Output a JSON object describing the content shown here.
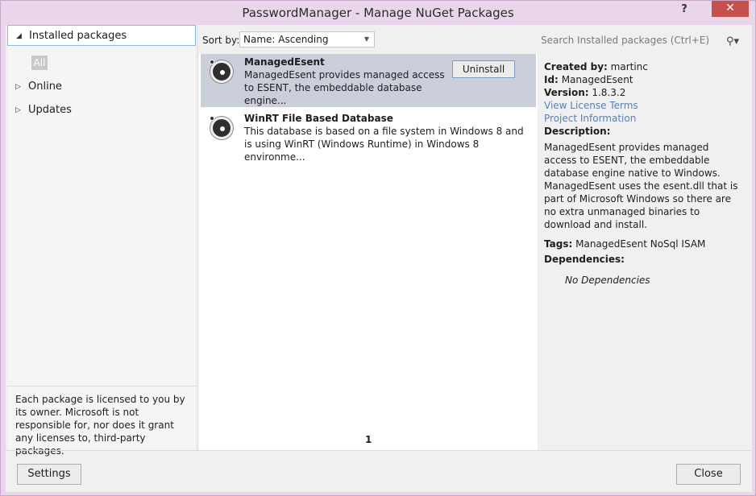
{
  "window": {
    "title": "PasswordManager - Manage NuGet Packages",
    "help_glyph": "?",
    "close_glyph": "✕"
  },
  "sidebar": {
    "items": [
      {
        "label": "Installed packages",
        "arrow": "◢"
      },
      {
        "label": "Online",
        "arrow": "▷"
      },
      {
        "label": "Updates",
        "arrow": "▷"
      }
    ],
    "filter_chip": "All",
    "license_note": "Each package is licensed to you by its owner. Microsoft is not responsible for, nor does it grant any licenses to, third-party packages."
  },
  "toolbar": {
    "sort_label": "Sort by:",
    "sort_value": "Name: Ascending",
    "search_placeholder": "Search Installed packages (Ctrl+E)"
  },
  "packages": [
    {
      "name": "ManagedEsent",
      "description": "ManagedEsent provides managed access to ESENT, the embeddable database engine...",
      "action": "Uninstall",
      "selected": true
    },
    {
      "name": "WinRT File Based Database",
      "description": "This database is based on a file system in Windows 8 and is using WinRT (Windows Runtime) in Windows 8 environme...",
      "selected": false
    }
  ],
  "pager": {
    "current_page": "1"
  },
  "details": {
    "created_by_label": "Created by:",
    "created_by": "martinc",
    "id_label": "Id:",
    "id": "ManagedEsent",
    "version_label": "Version:",
    "version": "1.8.3.2",
    "license_link": "View License Terms",
    "project_link": "Project Information",
    "description_label": "Description:",
    "description": "ManagedEsent provides managed access to ESENT, the embeddable database engine native to Windows. ManagedEsent uses the esent.dll that is part of Microsoft Windows so there are no extra unmanaged binaries to download and install.",
    "tags_label": "Tags:",
    "tags": "ManagedEsent NoSql ISAM",
    "dependencies_label": "Dependencies:",
    "dependencies": "No Dependencies"
  },
  "footer": {
    "settings_label": "Settings",
    "close_label": "Close"
  }
}
